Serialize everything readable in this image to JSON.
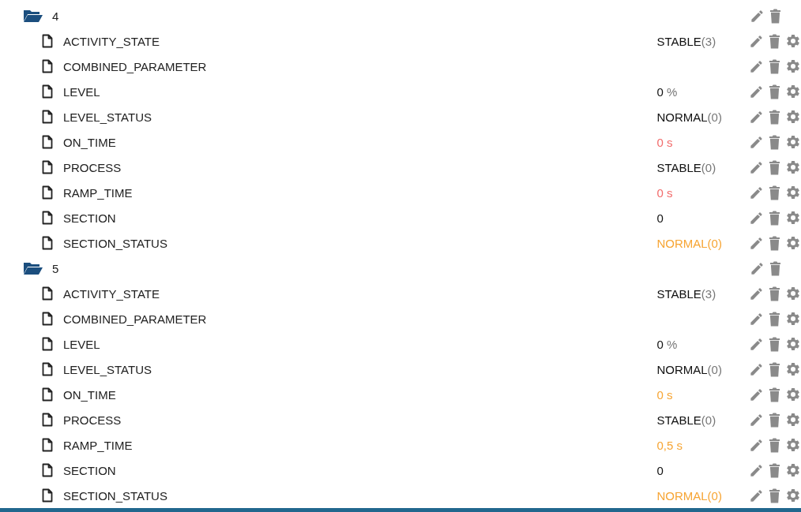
{
  "folders": [
    {
      "label": "4",
      "expanded": true,
      "items": [
        {
          "name": "ACTIVITY_STATE",
          "value": "STABLE",
          "suffix": "(3)",
          "color": "#111111"
        },
        {
          "name": "COMBINED_PARAMETER"
        },
        {
          "name": "LEVEL",
          "value": "0",
          "suffix": " %",
          "color": "#111111"
        },
        {
          "name": "LEVEL_STATUS",
          "value": "NORMAL",
          "suffix": "(0)",
          "color": "#111111"
        },
        {
          "name": "ON_TIME",
          "value": "0 s",
          "color": "#f26b6b"
        },
        {
          "name": "PROCESS",
          "value": "STABLE",
          "suffix": "(0)",
          "color": "#111111"
        },
        {
          "name": "RAMP_TIME",
          "value": "0 s",
          "color": "#f26b6b"
        },
        {
          "name": "SECTION",
          "value": "0",
          "color": "#111111"
        },
        {
          "name": "SECTION_STATUS",
          "value": "NORMAL(0)",
          "color": "#f7a534"
        }
      ]
    },
    {
      "label": "5",
      "expanded": true,
      "items": [
        {
          "name": "ACTIVITY_STATE",
          "value": "STABLE",
          "suffix": "(3)",
          "color": "#111111"
        },
        {
          "name": "COMBINED_PARAMETER"
        },
        {
          "name": "LEVEL",
          "value": "0",
          "suffix": " %",
          "color": "#111111"
        },
        {
          "name": "LEVEL_STATUS",
          "value": "NORMAL",
          "suffix": "(0)",
          "color": "#111111"
        },
        {
          "name": "ON_TIME",
          "value": "0 s",
          "color": "#f7a534"
        },
        {
          "name": "PROCESS",
          "value": "STABLE",
          "suffix": "(0)",
          "color": "#111111"
        },
        {
          "name": "RAMP_TIME",
          "value": "0,5 s",
          "color": "#f7a534"
        },
        {
          "name": "SECTION",
          "value": "0",
          "color": "#111111"
        },
        {
          "name": "SECTION_STATUS",
          "value": "NORMAL(0)",
          "color": "#f7a534"
        }
      ]
    }
  ]
}
